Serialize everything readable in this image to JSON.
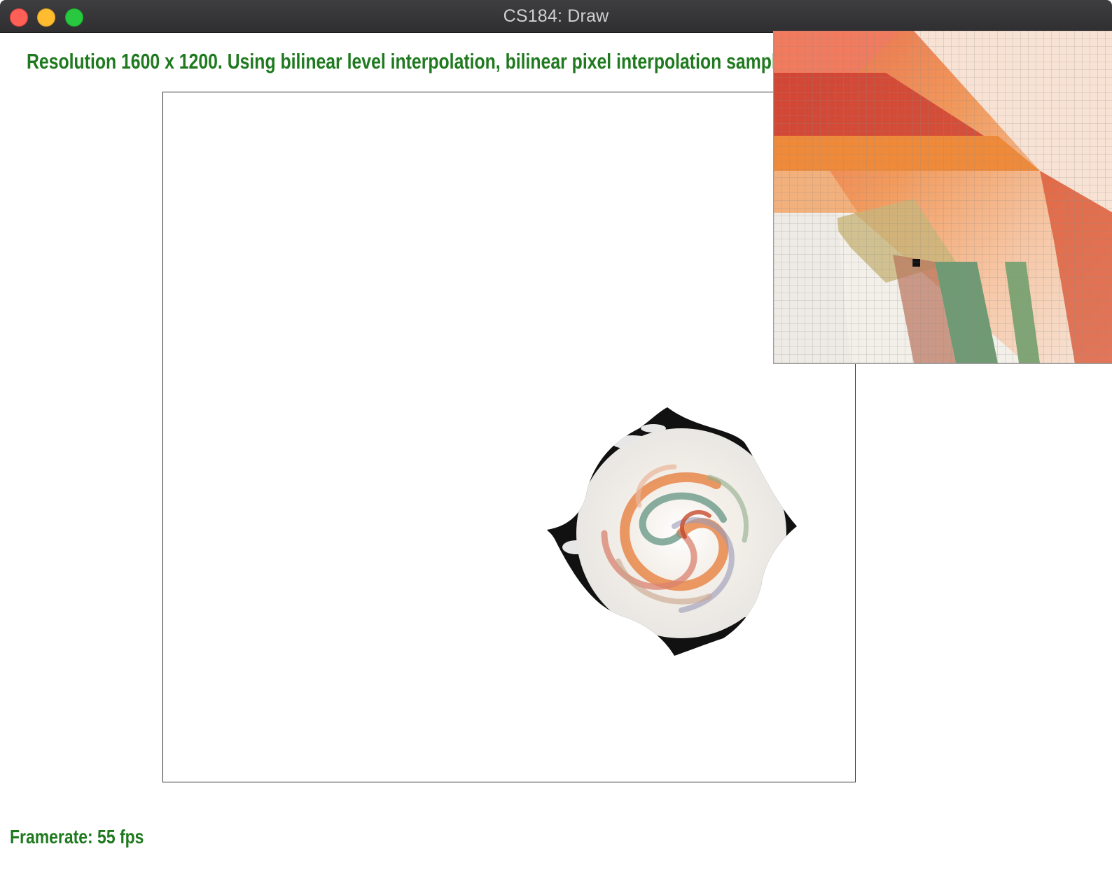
{
  "window": {
    "title": "CS184: Draw",
    "controls": [
      "close",
      "minimize",
      "zoom"
    ]
  },
  "status": {
    "message": "Resolution 1600 x 1200. Using bilinear level interpolation, bilinear pixel interpolation sampling. Supersample",
    "text_color": "#1f7a1f"
  },
  "footer": {
    "framerate": "Framerate: 55 fps"
  },
  "canvas": {
    "content": "swirled-texture-render"
  },
  "zoom_inspector": {
    "content": "pixel-grid-magnification"
  },
  "colors": {
    "titlebar": "#353537",
    "close": "#fe5f57",
    "minimize": "#febc2e",
    "zoom": "#28c840",
    "status_green": "#1f7a1f"
  }
}
